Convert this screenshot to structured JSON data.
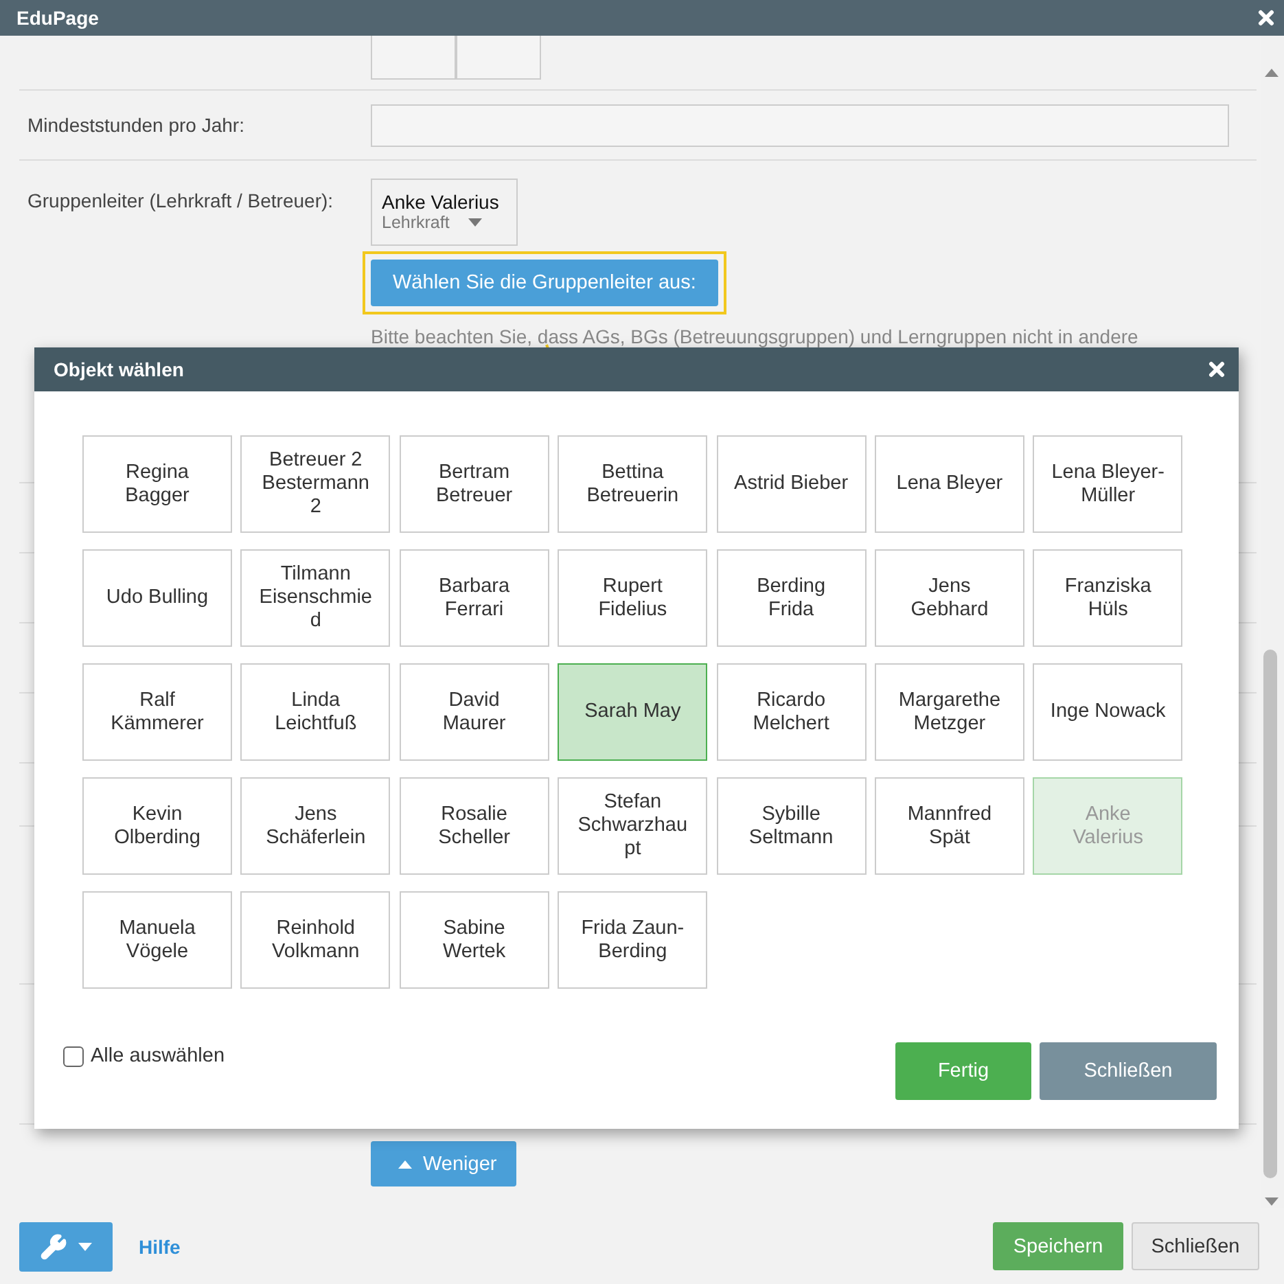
{
  "window": {
    "title": "EduPage"
  },
  "form": {
    "min_hours": {
      "label": "Mindeststunden pro Jahr:"
    },
    "leader": {
      "label": "Gruppenleiter (Lehrkraft / Betreuer):",
      "name": "Anke Valerius",
      "role": "Lehrkraft",
      "choose_button": "Wählen Sie die Gruppenleiter aus:",
      "hint": "Bitte beachten Sie, dass AGs, BGs (Betreuungsgruppen) und Lerngruppen nicht in andere"
    },
    "less_button": "Weniger"
  },
  "dialog": {
    "title": "Objekt wählen",
    "items": [
      {
        "name": "Regina Bagger",
        "selected": false,
        "disabled": false
      },
      {
        "name": "Betreuer 2 Bestermann 2",
        "selected": false,
        "disabled": false
      },
      {
        "name": "Bertram Betreuer",
        "selected": false,
        "disabled": false
      },
      {
        "name": "Bettina Betreuerin",
        "selected": false,
        "disabled": false
      },
      {
        "name": "Astrid Bieber",
        "selected": false,
        "disabled": false
      },
      {
        "name": "Lena Bleyer",
        "selected": false,
        "disabled": false
      },
      {
        "name": "Lena Bleyer-Müller",
        "selected": false,
        "disabled": false
      },
      {
        "name": "Udo Bulling",
        "selected": false,
        "disabled": false
      },
      {
        "name": "Tilmann Eisenschmied",
        "selected": false,
        "disabled": false
      },
      {
        "name": "Barbara Ferrari",
        "selected": false,
        "disabled": false
      },
      {
        "name": "Rupert Fidelius",
        "selected": false,
        "disabled": false
      },
      {
        "name": "Berding Frida",
        "selected": false,
        "disabled": false
      },
      {
        "name": "Jens Gebhard",
        "selected": false,
        "disabled": false
      },
      {
        "name": "Franziska Hüls",
        "selected": false,
        "disabled": false
      },
      {
        "name": "Ralf Kämmerer",
        "selected": false,
        "disabled": false
      },
      {
        "name": "Linda Leichtfuß",
        "selected": false,
        "disabled": false
      },
      {
        "name": "David Maurer",
        "selected": false,
        "disabled": false
      },
      {
        "name": "Sarah May",
        "selected": true,
        "disabled": false
      },
      {
        "name": "Ricardo Melchert",
        "selected": false,
        "disabled": false
      },
      {
        "name": "Margarethe Metzger",
        "selected": false,
        "disabled": false
      },
      {
        "name": "Inge Nowack",
        "selected": false,
        "disabled": false
      },
      {
        "name": "Kevin Olberding",
        "selected": false,
        "disabled": false
      },
      {
        "name": "Jens Schäferlein",
        "selected": false,
        "disabled": false
      },
      {
        "name": "Rosalie Scheller",
        "selected": false,
        "disabled": false
      },
      {
        "name": "Stefan Schwarzhaupt",
        "selected": false,
        "disabled": false
      },
      {
        "name": "Sybille Seltmann",
        "selected": false,
        "disabled": false
      },
      {
        "name": "Mannfred Spät",
        "selected": false,
        "disabled": false
      },
      {
        "name": "Anke Valerius",
        "selected": false,
        "disabled": true
      },
      {
        "name": "Manuela Vögele",
        "selected": false,
        "disabled": false
      },
      {
        "name": "Reinhold Volkmann",
        "selected": false,
        "disabled": false
      },
      {
        "name": "Sabine Wertek",
        "selected": false,
        "disabled": false
      },
      {
        "name": "Frida Zaun-Berding",
        "selected": false,
        "disabled": false
      }
    ],
    "select_all": {
      "label": "Alle auswählen",
      "checked": false
    },
    "done_button": "Fertig",
    "close_button": "Schließen"
  },
  "footer": {
    "help_link": "Hilfe",
    "save_button": "Speichern",
    "close_button": "Schließen"
  }
}
